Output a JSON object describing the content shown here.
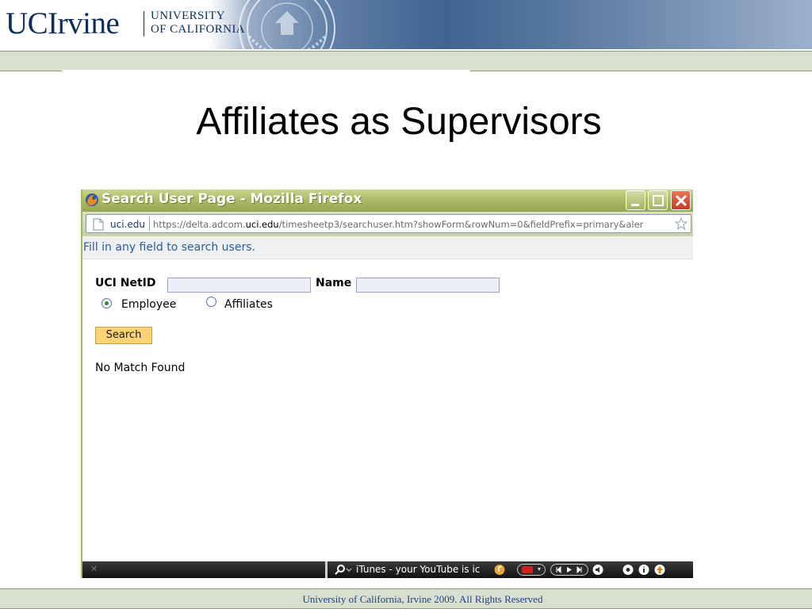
{
  "slide": {
    "brand_name": "UCIrvine",
    "brand_university_line1": "UNIVERSITY",
    "brand_university_line2": "OF CALIFORNIA",
    "title": "Affiliates as Supervisors",
    "footer": "University of California, Irvine 2009. All Rights Reserved"
  },
  "browser": {
    "window_title": "Search User Page - Mozilla Firefox",
    "site_identity": "uci.edu",
    "url_prefix": "https://delta.adcom.",
    "url_domain": "uci.edu",
    "url_suffix": "/timesheetp3/searchuser.htm?showForm&rowNum=0&fieldPrefix=primary&aler"
  },
  "page": {
    "instruction": "Fill in any field to search users.",
    "netid_label": "UCI NetID",
    "netid_value": "",
    "name_label": "Name",
    "name_value": "",
    "radio_employee": "Employee",
    "radio_affiliates": "Affiliates",
    "selected_radio": "Employee",
    "search_button": "Search",
    "result_message": "No Match Found"
  },
  "taskbar": {
    "now_playing": "iTunes - your YouTube is ic"
  },
  "colors": {
    "titlebar": "#a9b764",
    "brand_navy": "#0d2d5a",
    "notice_text": "#2a5d9c",
    "search_button": "#fbd275",
    "footer_band": "#d9e0cf"
  }
}
